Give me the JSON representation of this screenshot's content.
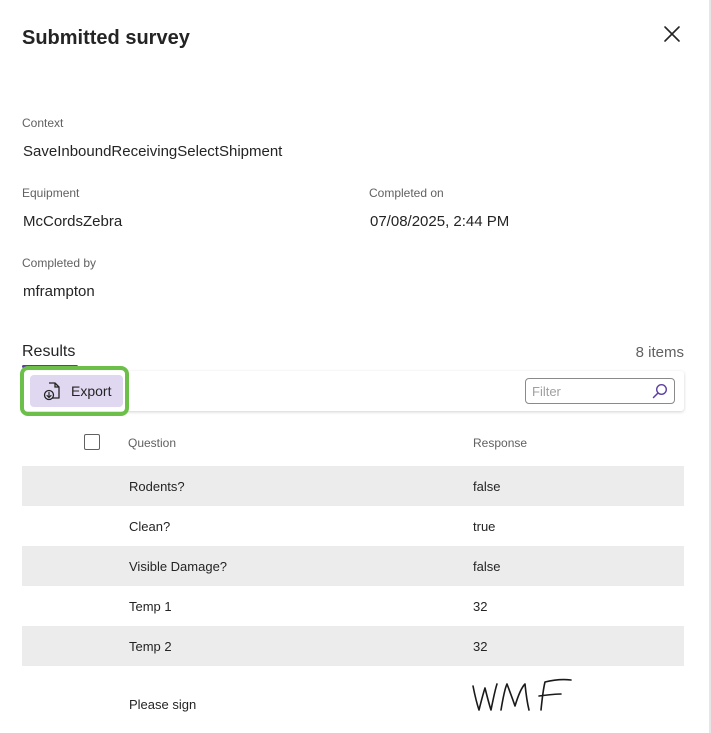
{
  "panel": {
    "title": "Submitted survey"
  },
  "details": {
    "context_label": "Context",
    "context_value": "SaveInboundReceivingSelectShipment",
    "equipment_label": "Equipment",
    "equipment_value": "McCordsZebra",
    "completed_on_label": "Completed on",
    "completed_on_value": "07/08/2025, 2:44 PM",
    "completed_by_label": "Completed by",
    "completed_by_value": "mframpton"
  },
  "results": {
    "tab_label": "Results",
    "count_text": "8 items",
    "export_label": "Export",
    "filter_placeholder": "Filter",
    "columns": {
      "question": "Question",
      "response": "Response"
    },
    "rows": [
      {
        "question": "Rodents?",
        "response": "false"
      },
      {
        "question": "Clean?",
        "response": "true"
      },
      {
        "question": "Visible Damage?",
        "response": "false"
      },
      {
        "question": "Temp 1",
        "response": "32"
      },
      {
        "question": "Temp 2",
        "response": "32"
      },
      {
        "question": "Please sign",
        "response": "WMF"
      }
    ]
  },
  "colors": {
    "accent": "#5b3fa0",
    "export_bg": "#e0d7f1",
    "highlight": "#6cc04a",
    "row_alt": "#ececec"
  },
  "icons": {
    "close": "close-icon",
    "export": "export-icon",
    "search": "search-icon",
    "signature": "signature-image"
  }
}
